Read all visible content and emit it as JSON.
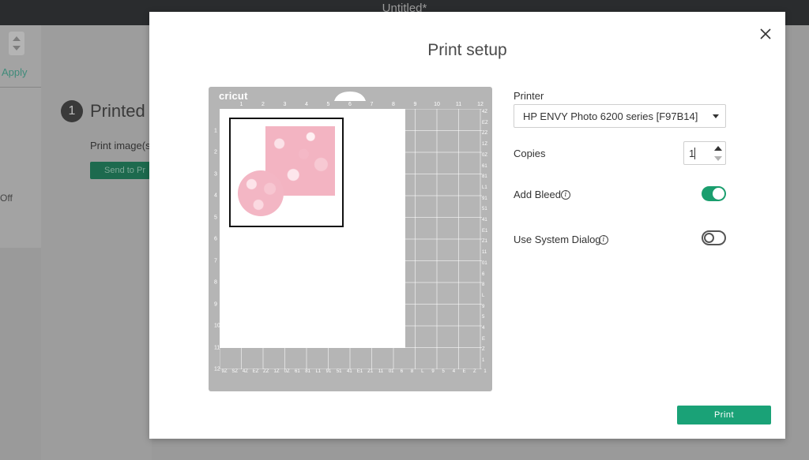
{
  "window": {
    "title": "Untitled*"
  },
  "background": {
    "apply_label": "Apply",
    "off_label": "Off",
    "step_number": "1",
    "step_title": "Printed",
    "print_image_label": "Print image(s",
    "send_button_label": "Send to Pr"
  },
  "dialog": {
    "title": "Print setup",
    "close_icon": "close-icon",
    "mat": {
      "logo": "cricut",
      "top_ruler": [
        "1",
        "2",
        "3",
        "4",
        "5",
        "6",
        "7",
        "8",
        "9",
        "10",
        "11",
        "12"
      ],
      "left_ruler": [
        "1",
        "2",
        "3",
        "4",
        "5",
        "6",
        "7",
        "8",
        "9",
        "10",
        "11",
        "12"
      ],
      "right_ruler": [
        "4Z",
        "EZ",
        "ZZ",
        "1Z",
        "0Z",
        "61",
        "81",
        "L1",
        "91",
        "51",
        "41",
        "E1",
        "Z1",
        "11",
        "01",
        "6",
        "8",
        "L",
        "9",
        "5",
        "4",
        "E",
        "Z",
        "1"
      ],
      "bottom_ruler": [
        "9Z",
        "SZ",
        "4Z",
        "EZ",
        "ZZ",
        "1Z",
        "0Z",
        "61",
        "81",
        "L1",
        "91",
        "51",
        "41",
        "E1",
        "Z1",
        "11",
        "01",
        "6",
        "8",
        "L",
        "9",
        "5",
        "4",
        "E",
        "Z",
        "1"
      ],
      "colors": {
        "mat": "#b5b5b5",
        "design_pink": "#f3b4c2"
      }
    },
    "printer": {
      "label": "Printer",
      "value": "HP ENVY Photo 6200 series [F97B14]"
    },
    "copies": {
      "label": "Copies",
      "value": "1"
    },
    "add_bleed": {
      "label": "Add Bleed",
      "info_glyph": "i",
      "enabled": true
    },
    "system_dialog": {
      "label": "Use System Dialog",
      "info_glyph": "i",
      "enabled": false
    },
    "print_button": "Print",
    "accent_color": "#1aa277"
  }
}
